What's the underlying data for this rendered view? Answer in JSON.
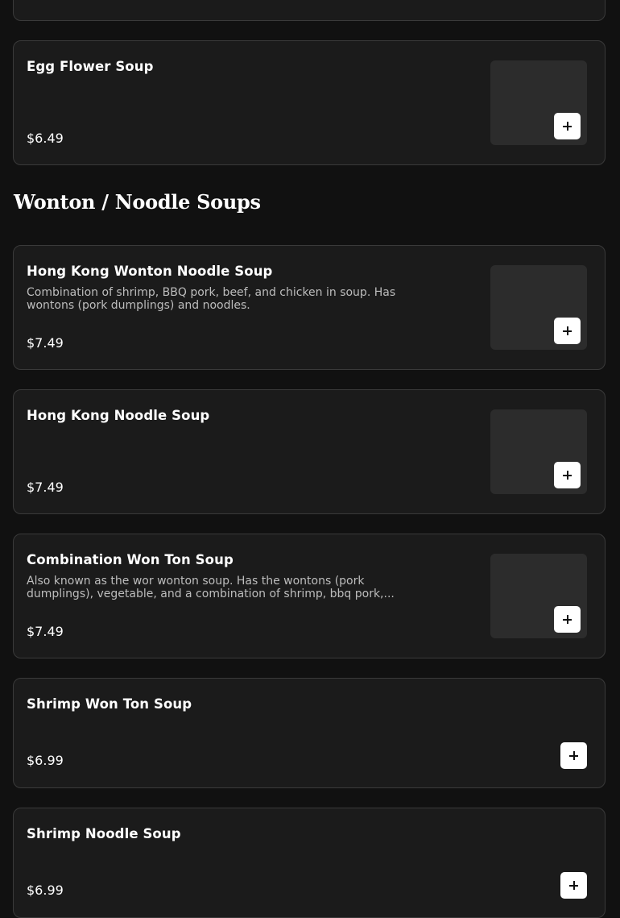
{
  "previous_section_items": [
    {
      "name": "Egg Flower Soup",
      "description": "",
      "price": "$6.49",
      "has_image": true
    }
  ],
  "section": {
    "title": "Wonton / Noodle Soups",
    "items": [
      {
        "name": "Hong Kong Wonton Noodle Soup",
        "description": "Combination of shrimp, BBQ pork, beef, and chicken in soup. Has wontons (pork dumplings) and noodles.",
        "price": "$7.49",
        "has_image": true
      },
      {
        "name": "Hong Kong Noodle Soup",
        "description": "",
        "price": "$7.49",
        "has_image": true
      },
      {
        "name": "Combination Won Ton Soup",
        "description": "Also known as the wor wonton soup. Has the wontons (pork dumplings), vegetable, and a combination of shrimp, bbq pork,...",
        "price": "$7.49",
        "has_image": true
      },
      {
        "name": "Shrimp Won Ton Soup",
        "description": "",
        "price": "$6.99",
        "has_image": false
      },
      {
        "name": "Shrimp Noodle Soup",
        "description": "",
        "price": "$6.99",
        "has_image": false
      }
    ]
  },
  "icons": {
    "add": "plus-icon"
  },
  "colors": {
    "background": "#111111",
    "card": "#1b1b1b",
    "card_border": "#3a3a3a",
    "text": "#ffffff",
    "muted_text": "#bdbdbd",
    "button": "#ffffff"
  }
}
